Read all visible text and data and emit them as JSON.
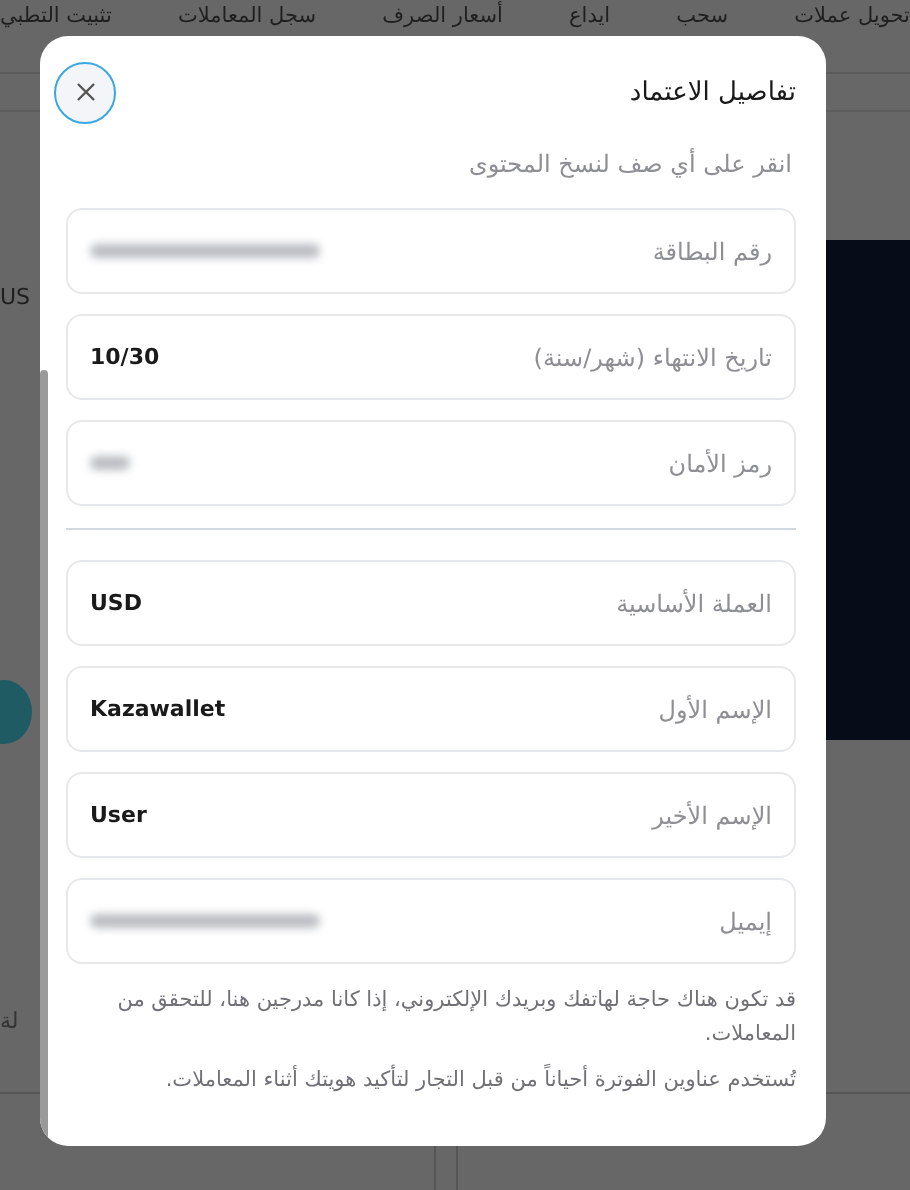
{
  "nav": {
    "items": [
      "تحويل عملات",
      "سحب",
      "ايداع",
      "أسعار الصرف",
      "سجل المعاملات",
      "تثبيت التطبي"
    ]
  },
  "background": {
    "fragments": [
      "US",
      "لة"
    ]
  },
  "modal": {
    "title": "تفاصيل الاعتماد",
    "subtitle": "انقر على أي صف لنسخ المحتوى",
    "sections": [
      {
        "fields": [
          {
            "label": "رقم البطاقة",
            "kind": "redacted"
          },
          {
            "label": "تاريخ الانتهاء (شهر/سنة)",
            "kind": "text",
            "value": "10/30"
          },
          {
            "label": "رمز الأمان",
            "kind": "redacted_short"
          }
        ]
      },
      {
        "fields": [
          {
            "label": "العملة الأساسية",
            "kind": "text",
            "value": "USD"
          },
          {
            "label": "الإسم الأول",
            "kind": "text",
            "value": "Kazawallet"
          },
          {
            "label": "الإسم الأخير",
            "kind": "text",
            "value": "User"
          },
          {
            "label": "إيميل",
            "kind": "redacted"
          }
        ]
      }
    ],
    "notes": [
      "قد تكون هناك حاجة لهاتفك وبريدك الإلكتروني، إذا كانا مدرجين هنا، للتحقق من المعاملات.",
      "تُستخدم عناوين الفوترة أحياناً من قبل التجار لتأكيد هويتك أثناء المعاملات."
    ]
  }
}
